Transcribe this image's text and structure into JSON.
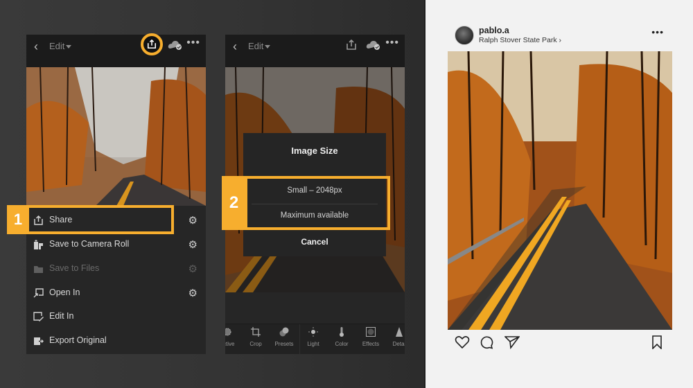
{
  "colors": {
    "highlight": "#f7ae2e",
    "dark_bg": "#262626",
    "topbar_bg": "#1b1b1b",
    "ig_bg": "#f2f2f2"
  },
  "phone1": {
    "topbar": {
      "back_icon": "chevron-left-icon",
      "edit_label": "Edit",
      "share_icon": "share-icon",
      "cloud_icon": "cloud-sync-icon",
      "more_icon": "more-horizontal-icon"
    },
    "step_badge": "1",
    "menu": [
      {
        "label": "Share",
        "icon": "share-icon",
        "gear": true,
        "disabled": false
      },
      {
        "label": "Save to Camera Roll",
        "icon": "camera-roll-icon",
        "gear": true,
        "disabled": false
      },
      {
        "label": "Save to Files",
        "icon": "folder-icon",
        "gear": true,
        "disabled": true
      },
      {
        "label": "Open In",
        "icon": "open-in-icon",
        "gear": true,
        "disabled": false
      },
      {
        "label": "Edit In",
        "icon": "edit-in-icon",
        "gear": false,
        "disabled": false
      },
      {
        "label": "Export Original",
        "icon": "export-icon",
        "gear": false,
        "disabled": false
      }
    ]
  },
  "phone2": {
    "topbar": {
      "back_icon": "chevron-left-icon",
      "edit_label": "Edit",
      "share_icon": "share-icon",
      "cloud_icon": "cloud-sync-icon",
      "more_icon": "more-horizontal-icon"
    },
    "step_badge": "2",
    "dialog": {
      "title": "Image Size",
      "options": [
        "Small – 2048px",
        "Maximum available"
      ],
      "cancel": "Cancel"
    },
    "toolbar": [
      "ective",
      "Crop",
      "Presets",
      "Light",
      "Color",
      "Effects",
      "Detai"
    ]
  },
  "instagram": {
    "username": "pablo.a",
    "location": "Ralph Stover State Park ›",
    "more_icon": "more-horizontal-icon",
    "actions": [
      "heart-icon",
      "comment-icon",
      "send-icon",
      "bookmark-icon"
    ]
  }
}
